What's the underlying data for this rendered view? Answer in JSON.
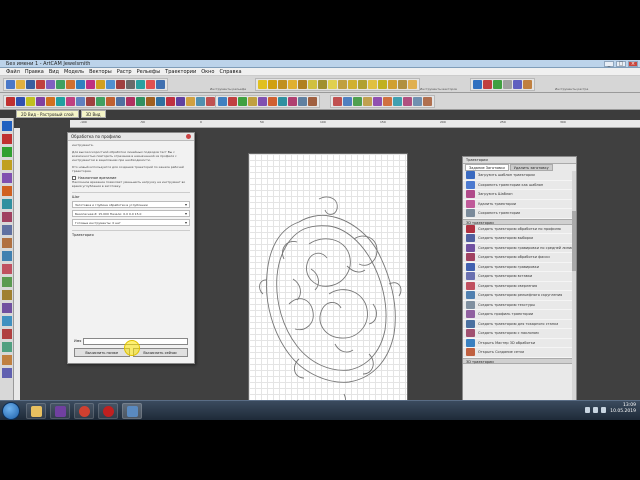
{
  "app": {
    "title": "Без имени 1 - ArtCAM Jewelsmith",
    "window_buttons": [
      "_",
      "□",
      "×"
    ]
  },
  "menu": [
    "Файл",
    "Правка",
    "Вид",
    "Модель",
    "Векторы",
    "Растр",
    "Рельефы",
    "Траектории",
    "Окно",
    "Справка"
  ],
  "toolbar_groups": [
    "Инструменты рельефа",
    "Инструменты векторов",
    "Инструменты растра"
  ],
  "doc_tabs": [
    "2D Вид - Растровый слой",
    "3D Вид"
  ],
  "ruler_marks": [
    "-100",
    "-50",
    "0",
    "50",
    "100",
    "150",
    "200",
    "250",
    "300"
  ],
  "dialog": {
    "title": "Обработка по профилю",
    "paragraphs": [
      "инструмента.",
      "Для высокоскоростной обработки линейных подходов тест Вы с возможностью повторить отрезание в назначенной из профиля с инструментом в зацеплении при необходимости.",
      "Кто новый используется для создания траекторий по канале рабочей траектории."
    ],
    "option_label": "Наклонное врезание",
    "option_text": "Наклонное врезание позволяет уменьшить нагрузку на инструмент во время углубления в заготовку.",
    "section_tools": "Шаг",
    "rows": [
      "Заготовка и глубина обработки в углублении",
      "Безопасная Z: 15.000 Начало: 0.0 0.0 15.0",
      "Готовые инструменты: 0 нет"
    ],
    "section_name": "Траектория",
    "name_label": "Имя",
    "btn_compute": "Вычислить позже",
    "btn_compute_now": "Вычислить сейчас"
  },
  "rpanel": {
    "title": "Траектории",
    "tabs": [
      "Задание Заготовки",
      "Удалить заготовку"
    ],
    "section1": "2D траектории",
    "items1": [
      "Загрузить шаблон траектории",
      "Сохранить траектории как шаблон",
      "Загрузить Шаблон",
      "Удалить траектории",
      "Сохранить траектории"
    ],
    "section2": "3D траектории",
    "items2": [
      "Создать траекторию обработки по профилю",
      "Создать траекторию выборки",
      "Создать траекторию гравировки по средней линии",
      "Создать траекторию обработки фаски",
      "Создать траекторию гравировки",
      "Создать траекторию вставки",
      "Создать траекторию сверления",
      "Создать траекторию рельефного скругления",
      "Создать траекторию текстуры",
      "Создать профиль траектории",
      "Создать траекторию для токарного станка",
      "Создать траекторию с наклоном",
      "Открыть Мастер 3D обработки",
      "Открыть Создание сетки"
    ],
    "section3": "3D траектории"
  },
  "status": {
    "x": "X: -604.25",
    "y": "Y: 59.00",
    "w": "W: 700.488",
    "h": "H: 553.448"
  },
  "palette": [
    "#000000",
    "#ffffff",
    "#ff0000",
    "#00c000",
    "#0050ff",
    "#00e0e0",
    "#ff00ff",
    "#ffff00",
    "#8a8a8a",
    "#c04000",
    "#ff8000",
    "#808000"
  ],
  "taskbar": {
    "time": "13:09",
    "date": "10.05.2019"
  }
}
